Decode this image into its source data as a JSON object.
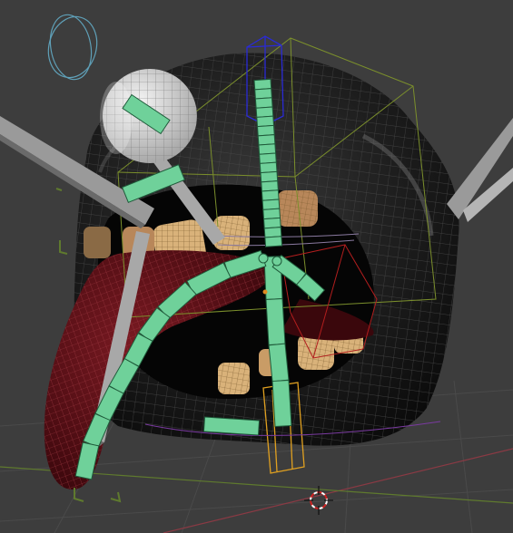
{
  "viewport": {
    "mode": "Pose Mode",
    "colors": {
      "background": "#3d3d3d",
      "grid": "#4a4a4a",
      "axis_x": "#8a3a44",
      "axis_y": "#5f7a2e",
      "bone": "#6fd19a",
      "bone_edge": "#1f5a3a",
      "mesh_dark": "#1a1a1a",
      "tongue": "#5a0f16",
      "teeth": "#d9b27a",
      "eyeball": "#d8d8d8",
      "rod": "#9a9a9a",
      "cage_green": "#7b8f2c",
      "cage_red": "#b21e1e",
      "cage_blue": "#2a2ad6",
      "cage_orange": "#e0a020",
      "empty_circle": "#5fa0b8"
    },
    "objects": {
      "head_mesh": "rubber-head",
      "tongue": "tongue",
      "armature": "armature-bones",
      "cursor": "3d-cursor"
    }
  }
}
